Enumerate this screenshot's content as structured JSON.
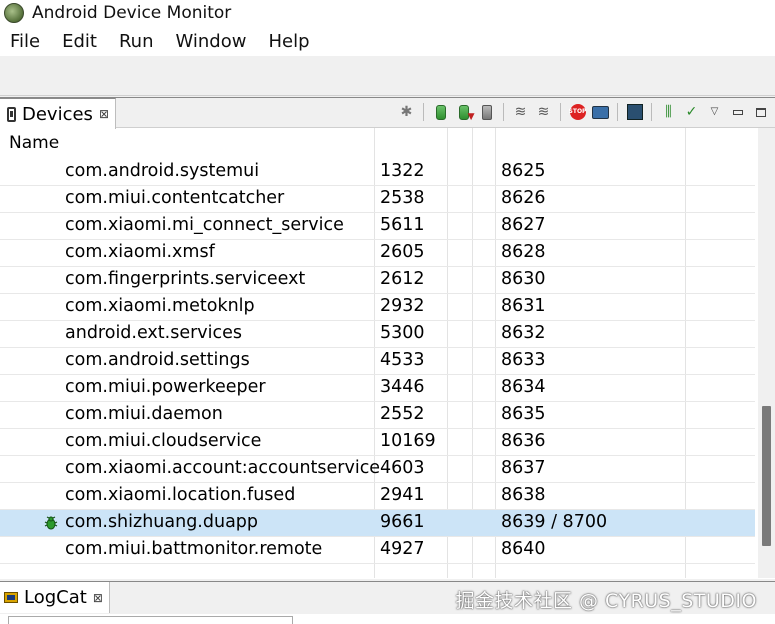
{
  "window": {
    "title": "Android Device Monitor"
  },
  "menu": [
    "File",
    "Edit",
    "Run",
    "Window",
    "Help"
  ],
  "devices_view": {
    "tab_label": "Devices",
    "close_glyph": "⊠",
    "column_name": "Name",
    "rows": [
      {
        "name": "com.android.systemui",
        "pid": "1322",
        "port": "8625"
      },
      {
        "name": "com.miui.contentcatcher",
        "pid": "2538",
        "port": "8626"
      },
      {
        "name": "com.xiaomi.mi_connect_service",
        "pid": "5611",
        "port": "8627"
      },
      {
        "name": "com.xiaomi.xmsf",
        "pid": "2605",
        "port": "8628"
      },
      {
        "name": "com.fingerprints.serviceext",
        "pid": "2612",
        "port": "8630"
      },
      {
        "name": "com.xiaomi.metoknlp",
        "pid": "2932",
        "port": "8631"
      },
      {
        "name": "android.ext.services",
        "pid": "5300",
        "port": "8632"
      },
      {
        "name": "com.android.settings",
        "pid": "4533",
        "port": "8633"
      },
      {
        "name": "com.miui.powerkeeper",
        "pid": "3446",
        "port": "8634"
      },
      {
        "name": "com.miui.daemon",
        "pid": "2552",
        "port": "8635"
      },
      {
        "name": "com.miui.cloudservice",
        "pid": "10169",
        "port": "8636"
      },
      {
        "name": "com.xiaomi.account:accountservice",
        "pid": "4603",
        "port": "8637"
      },
      {
        "name": "com.xiaomi.location.fused",
        "pid": "2941",
        "port": "8638"
      },
      {
        "name": "com.shizhuang.duapp",
        "pid": "9661",
        "port": "8639 / 8700",
        "selected": true,
        "debug_icon": "bug-icon"
      },
      {
        "name": "com.miui.battmonitor.remote",
        "pid": "4927",
        "port": "8640"
      }
    ],
    "toolbar_icons": [
      "debug-process-icon",
      "update-heap-icon",
      "dump-hprof-icon",
      "cause-gc-icon",
      "update-threads-icon",
      "start-method-profiling-icon",
      "stop-process-icon",
      "screen-capture-icon",
      "dump-view-hierarchy-icon",
      "systrace-icon",
      "opengl-trace-icon",
      "view-menu-icon",
      "minimize-icon",
      "maximize-icon"
    ]
  },
  "logcat_view": {
    "tab_label": "LogCat",
    "close_glyph": "⊠"
  },
  "watermark": "掘金技术社区 @ CYRUS_STUDIO",
  "colors": {
    "selection": "#cce4f7",
    "toolbar_bg": "#f0f0f0"
  }
}
